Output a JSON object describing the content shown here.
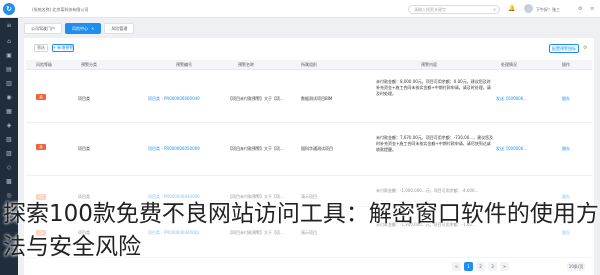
{
  "header": {
    "brand": "(系统名称) 北京某科技有限公司",
    "search_placeholder": "请输入搜索关键字",
    "greeting": "下午好！张三"
  },
  "tabs": [
    {
      "label": "公司驾驶门户"
    },
    {
      "label": "风险中心"
    },
    {
      "label": "风险管理"
    }
  ],
  "toolbar": {
    "filter_label": "筛选",
    "new_label": "+ 新增预警",
    "config_label": "配置预警指标"
  },
  "table": {
    "headers": [
      "风险等级",
      "预警分类",
      "预警编号",
      "预警名称",
      "所属组织",
      "预警内容",
      "处理情况",
      "操作"
    ],
    "rows": [
      {
        "level": "高",
        "category": "项目类",
        "code": "项目类 - PR000006060049",
        "name": "【项目未付款预警】大于【项...",
        "org": "数据测试项目BIM",
        "content": "未付款金额：8,000.00元，项目可用余额：0.00元，建议您及时补充资金+施工合同未核实金额+中期付款申请。请及时处理，请及时处理。",
        "status": "发送【000006...",
        "op": "跟办"
      },
      {
        "level": "高",
        "category": "项目类",
        "code": "项目类 - PR000006050009",
        "name": "【项目未付款预警】大于【项...",
        "org": "国科华通测试项目",
        "content": "未付款金额：7,670.00元，项目可用余额：-730,00...，建议您及时补充资金+施工合同未核实金额+中期付款申请，请尽快到达或收款提醒。",
        "status": "发送【000006...",
        "op": "跟办"
      },
      {
        "level": "中",
        "category": "项目类",
        "code": "项目类 - PR000006040009",
        "name": "【项目未付款预警】大于【项...",
        "org": "演示项目",
        "content": "未付款金额：-1,000,000...元，项目可用余额：-4,000...",
        "status": "",
        "op": "跟办"
      },
      {
        "level": "中",
        "category": "项目类",
        "code": "项目类 - PR000006040002",
        "name": "【项目未付款预警】大于【项...",
        "org": "演示项目",
        "content": "未付款金额：-1,900,000...元，项目可用余额：-1,00...",
        "status": "",
        "op": "跟办"
      }
    ]
  },
  "pager": {
    "pages": [
      "<",
      "1",
      "2",
      "3",
      ">"
    ],
    "size_label": "10条/页"
  },
  "overlay_caption": "探索100款免费不良网站访问工具：解密窗口软件的使用方法与安全风险"
}
